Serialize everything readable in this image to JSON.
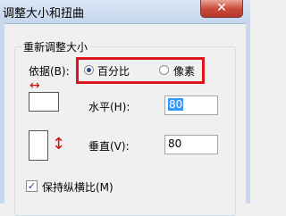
{
  "window": {
    "title": "调整大小和扭曲",
    "close_glyph": "✕"
  },
  "resize": {
    "group_label": "重新调整大小",
    "basis_label": "依据(B):",
    "options": [
      {
        "label": "百分比",
        "selected": true
      },
      {
        "label": "像素",
        "selected": false
      }
    ],
    "horizontal_label": "水平(H):",
    "horizontal_value": "80",
    "vertical_label": "垂直(V):",
    "vertical_value": "80",
    "keep_ratio_label": "保持纵横比(M)",
    "keep_ratio_checked": true,
    "keep_ratio_glyph": "✓",
    "arrow_h_glyph": "↔",
    "arrow_v_glyph": "↕"
  },
  "colors": {
    "highlight": "#e0141c",
    "selection": "#3399ff",
    "arrow": "#c81010"
  }
}
